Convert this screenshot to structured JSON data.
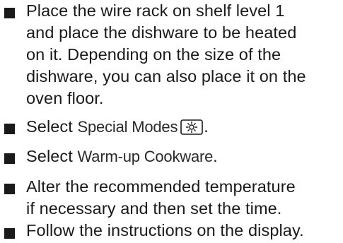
{
  "steps": [
    {
      "lines": [
        "Place the wire rack on shelf level 1",
        "and place the dishware to be heated",
        "on it. Depending on the size of the",
        "dishware, you can also place it on the",
        "oven floor."
      ]
    },
    {
      "prefix": "Select ",
      "term": "Special Modes",
      "icon": "special-modes-icon",
      "suffix": "."
    },
    {
      "prefix": "Select ",
      "term": "Warm-up Cookware",
      "suffix": "."
    },
    {
      "lines": [
        "Alter the recommended temperature",
        "if necessary and then set the time."
      ]
    },
    {
      "lines": [
        "Follow the instructions on the display."
      ]
    }
  ]
}
